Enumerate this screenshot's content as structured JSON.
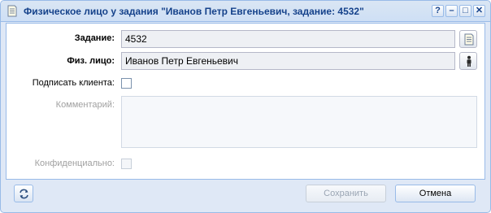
{
  "window": {
    "title": "Физическое лицо у задания \"Иванов Петр Евгеньевич, задание: 4532\"",
    "tools": {
      "help": "?",
      "minimize": "–",
      "maximize": "□",
      "close": "✕"
    }
  },
  "form": {
    "task": {
      "label": "Задание:",
      "value": "4532"
    },
    "person": {
      "label": "Физ. лицо:",
      "value": "Иванов Петр Евгеньевич"
    },
    "sign_client": {
      "label": "Подписать клиента:",
      "checked": false
    },
    "comment": {
      "label": "Комментарий:",
      "value": ""
    },
    "confidential": {
      "label": "Конфиденциально:",
      "checked": false
    }
  },
  "footer": {
    "save_label": "Сохранить",
    "cancel_label": "Отмена"
  },
  "colors": {
    "title_text": "#15428b",
    "window_bg": "#dfe8f6",
    "border": "#99bbe8"
  }
}
